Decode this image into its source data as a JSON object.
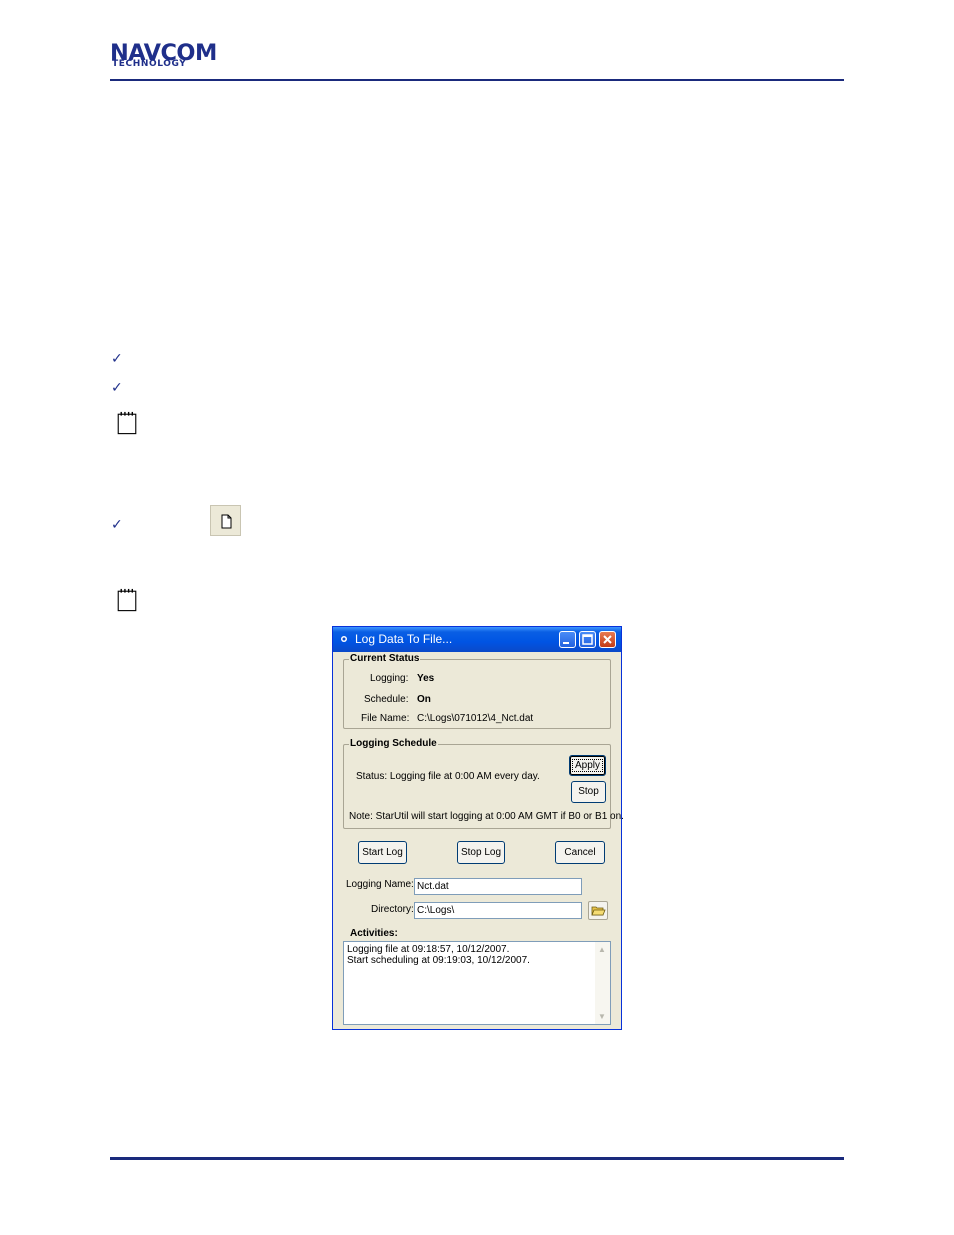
{
  "header": {
    "logo_top": "NAVCOM",
    "logo_bottom": "TECHNOLOGY"
  },
  "icons": {
    "check": "✓",
    "checkmark": "checkmark-icon",
    "note": "notepad-icon",
    "new_file": "new-file-icon"
  },
  "dialog": {
    "title": "Log Data To File...",
    "current_status": {
      "label": "Current Status",
      "logging_label": "Logging:",
      "logging_value": "Yes",
      "schedule_label": "Schedule:",
      "schedule_value": "On",
      "file_name_label": "File Name:",
      "file_name_value": "C:\\Logs\\071012\\4_Nct.dat"
    },
    "logging_schedule": {
      "label": "Logging Schedule",
      "status_text": "Status:  Logging file at 0:00 AM every day.",
      "apply_label": "Apply",
      "stop_label": "Stop",
      "note_text": "Note: StarUtil will start logging at 0:00 AM GMT if B0 or B1 on."
    },
    "buttons": {
      "start_log": "Start Log",
      "stop_log": "Stop Log",
      "cancel": "Cancel"
    },
    "logging_name_label": "Logging Name:",
    "logging_name_value": "Nct.dat",
    "directory_label": "Directory:",
    "directory_value": "C:\\Logs\\",
    "activities_label": "Activities:",
    "activities": [
      "Logging file at 09:18:57, 10/12/2007.",
      "Start scheduling at 09:19:03, 10/12/2007."
    ]
  },
  "colors": {
    "brand": "#1f2f8a",
    "rule": "#1a2a7c",
    "titlebar": "#0054e3",
    "dialog_bg": "#ece9d8"
  }
}
